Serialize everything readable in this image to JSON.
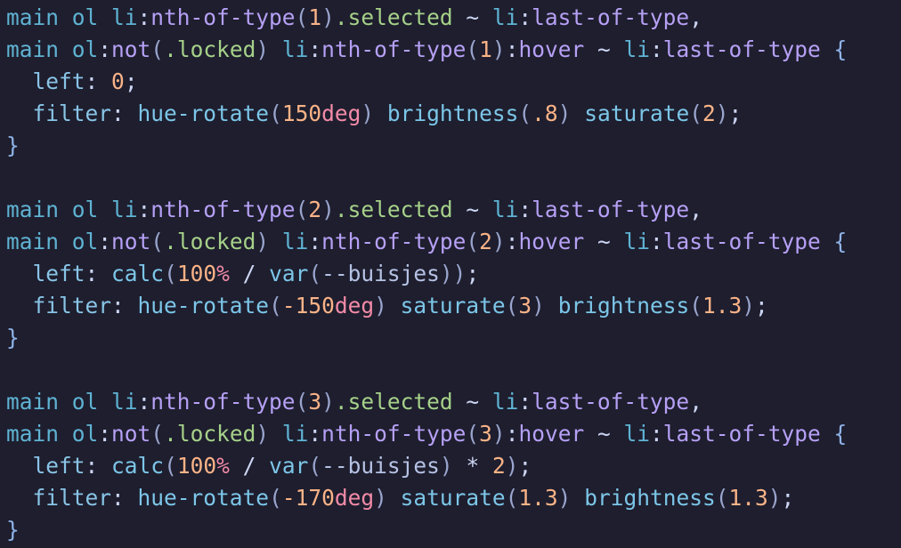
{
  "editor": {
    "colors": {
      "ident": "#5fb3d3",
      "func": "#7cc6e8",
      "punct": "#cdd6f4",
      "paren": "#9aa5ce",
      "pseudo": "#b6a0f5",
      "klass": "#a6d189",
      "number": "#fab387",
      "unit": "#f38ba8",
      "prop": "#89c4e6",
      "brace": "#8fb3e8",
      "var": "#b6c2e4"
    },
    "lines": [
      [
        {
          "t": "main ol ",
          "c": "ident"
        },
        {
          "t": "li",
          "c": "ident"
        },
        {
          "t": ":",
          "c": "punct"
        },
        {
          "t": "nth-of-type",
          "c": "pseudo"
        },
        {
          "t": "(",
          "c": "paren"
        },
        {
          "t": "1",
          "c": "number"
        },
        {
          "t": ")",
          "c": "paren"
        },
        {
          "t": ".selected",
          "c": "klass"
        },
        {
          "t": " ~ ",
          "c": "punct"
        },
        {
          "t": "li",
          "c": "ident"
        },
        {
          "t": ":",
          "c": "punct"
        },
        {
          "t": "last-of-type",
          "c": "pseudo"
        },
        {
          "t": ",",
          "c": "punct"
        }
      ],
      [
        {
          "t": "main ol",
          "c": "ident"
        },
        {
          "t": ":",
          "c": "punct"
        },
        {
          "t": "not",
          "c": "pseudo"
        },
        {
          "t": "(",
          "c": "paren"
        },
        {
          "t": ".locked",
          "c": "klass"
        },
        {
          "t": ") ",
          "c": "paren"
        },
        {
          "t": "li",
          "c": "ident"
        },
        {
          "t": ":",
          "c": "punct"
        },
        {
          "t": "nth-of-type",
          "c": "pseudo"
        },
        {
          "t": "(",
          "c": "paren"
        },
        {
          "t": "1",
          "c": "number"
        },
        {
          "t": ")",
          "c": "paren"
        },
        {
          "t": ":",
          "c": "punct"
        },
        {
          "t": "hover",
          "c": "pseudo"
        },
        {
          "t": " ~ ",
          "c": "punct"
        },
        {
          "t": "li",
          "c": "ident"
        },
        {
          "t": ":",
          "c": "punct"
        },
        {
          "t": "last-of-type",
          "c": "pseudo"
        },
        {
          "t": " {",
          "c": "brace"
        }
      ],
      [
        {
          "t": "  ",
          "c": "punct"
        },
        {
          "t": "left",
          "c": "prop"
        },
        {
          "t": ": ",
          "c": "punct"
        },
        {
          "t": "0",
          "c": "number"
        },
        {
          "t": ";",
          "c": "punct"
        }
      ],
      [
        {
          "t": "  ",
          "c": "punct"
        },
        {
          "t": "filter",
          "c": "prop"
        },
        {
          "t": ": ",
          "c": "punct"
        },
        {
          "t": "hue-rotate",
          "c": "func"
        },
        {
          "t": "(",
          "c": "paren"
        },
        {
          "t": "150",
          "c": "number"
        },
        {
          "t": "deg",
          "c": "unit"
        },
        {
          "t": ") ",
          "c": "paren"
        },
        {
          "t": "brightness",
          "c": "func"
        },
        {
          "t": "(",
          "c": "paren"
        },
        {
          "t": ".8",
          "c": "number"
        },
        {
          "t": ") ",
          "c": "paren"
        },
        {
          "t": "saturate",
          "c": "func"
        },
        {
          "t": "(",
          "c": "paren"
        },
        {
          "t": "2",
          "c": "number"
        },
        {
          "t": ")",
          "c": "paren"
        },
        {
          "t": ";",
          "c": "punct"
        }
      ],
      [
        {
          "t": "}",
          "c": "brace"
        }
      ],
      [],
      [
        {
          "t": "main ol ",
          "c": "ident"
        },
        {
          "t": "li",
          "c": "ident"
        },
        {
          "t": ":",
          "c": "punct"
        },
        {
          "t": "nth-of-type",
          "c": "pseudo"
        },
        {
          "t": "(",
          "c": "paren"
        },
        {
          "t": "2",
          "c": "number"
        },
        {
          "t": ")",
          "c": "paren"
        },
        {
          "t": ".selected",
          "c": "klass"
        },
        {
          "t": " ~ ",
          "c": "punct"
        },
        {
          "t": "li",
          "c": "ident"
        },
        {
          "t": ":",
          "c": "punct"
        },
        {
          "t": "last-of-type",
          "c": "pseudo"
        },
        {
          "t": ",",
          "c": "punct"
        }
      ],
      [
        {
          "t": "main ol",
          "c": "ident"
        },
        {
          "t": ":",
          "c": "punct"
        },
        {
          "t": "not",
          "c": "pseudo"
        },
        {
          "t": "(",
          "c": "paren"
        },
        {
          "t": ".locked",
          "c": "klass"
        },
        {
          "t": ") ",
          "c": "paren"
        },
        {
          "t": "li",
          "c": "ident"
        },
        {
          "t": ":",
          "c": "punct"
        },
        {
          "t": "nth-of-type",
          "c": "pseudo"
        },
        {
          "t": "(",
          "c": "paren"
        },
        {
          "t": "2",
          "c": "number"
        },
        {
          "t": ")",
          "c": "paren"
        },
        {
          "t": ":",
          "c": "punct"
        },
        {
          "t": "hover",
          "c": "pseudo"
        },
        {
          "t": " ~ ",
          "c": "punct"
        },
        {
          "t": "li",
          "c": "ident"
        },
        {
          "t": ":",
          "c": "punct"
        },
        {
          "t": "last-of-type",
          "c": "pseudo"
        },
        {
          "t": " {",
          "c": "brace"
        }
      ],
      [
        {
          "t": "  ",
          "c": "punct"
        },
        {
          "t": "left",
          "c": "prop"
        },
        {
          "t": ": ",
          "c": "punct"
        },
        {
          "t": "calc",
          "c": "func"
        },
        {
          "t": "(",
          "c": "paren"
        },
        {
          "t": "100",
          "c": "number"
        },
        {
          "t": "%",
          "c": "unit"
        },
        {
          "t": " / ",
          "c": "punct"
        },
        {
          "t": "var",
          "c": "func"
        },
        {
          "t": "(",
          "c": "paren"
        },
        {
          "t": "--buisjes",
          "c": "var"
        },
        {
          "t": "))",
          "c": "paren"
        },
        {
          "t": ";",
          "c": "punct"
        }
      ],
      [
        {
          "t": "  ",
          "c": "punct"
        },
        {
          "t": "filter",
          "c": "prop"
        },
        {
          "t": ": ",
          "c": "punct"
        },
        {
          "t": "hue-rotate",
          "c": "func"
        },
        {
          "t": "(",
          "c": "paren"
        },
        {
          "t": "-150",
          "c": "number"
        },
        {
          "t": "deg",
          "c": "unit"
        },
        {
          "t": ") ",
          "c": "paren"
        },
        {
          "t": "saturate",
          "c": "func"
        },
        {
          "t": "(",
          "c": "paren"
        },
        {
          "t": "3",
          "c": "number"
        },
        {
          "t": ") ",
          "c": "paren"
        },
        {
          "t": "brightness",
          "c": "func"
        },
        {
          "t": "(",
          "c": "paren"
        },
        {
          "t": "1.3",
          "c": "number"
        },
        {
          "t": ")",
          "c": "paren"
        },
        {
          "t": ";",
          "c": "punct"
        }
      ],
      [
        {
          "t": "}",
          "c": "brace"
        }
      ],
      [],
      [
        {
          "t": "main ol ",
          "c": "ident"
        },
        {
          "t": "li",
          "c": "ident"
        },
        {
          "t": ":",
          "c": "punct"
        },
        {
          "t": "nth-of-type",
          "c": "pseudo"
        },
        {
          "t": "(",
          "c": "paren"
        },
        {
          "t": "3",
          "c": "number"
        },
        {
          "t": ")",
          "c": "paren"
        },
        {
          "t": ".selected",
          "c": "klass"
        },
        {
          "t": " ~ ",
          "c": "punct"
        },
        {
          "t": "li",
          "c": "ident"
        },
        {
          "t": ":",
          "c": "punct"
        },
        {
          "t": "last-of-type",
          "c": "pseudo"
        },
        {
          "t": ",",
          "c": "punct"
        }
      ],
      [
        {
          "t": "main ol",
          "c": "ident"
        },
        {
          "t": ":",
          "c": "punct"
        },
        {
          "t": "not",
          "c": "pseudo"
        },
        {
          "t": "(",
          "c": "paren"
        },
        {
          "t": ".locked",
          "c": "klass"
        },
        {
          "t": ") ",
          "c": "paren"
        },
        {
          "t": "li",
          "c": "ident"
        },
        {
          "t": ":",
          "c": "punct"
        },
        {
          "t": "nth-of-type",
          "c": "pseudo"
        },
        {
          "t": "(",
          "c": "paren"
        },
        {
          "t": "3",
          "c": "number"
        },
        {
          "t": ")",
          "c": "paren"
        },
        {
          "t": ":",
          "c": "punct"
        },
        {
          "t": "hover",
          "c": "pseudo"
        },
        {
          "t": " ~ ",
          "c": "punct"
        },
        {
          "t": "li",
          "c": "ident"
        },
        {
          "t": ":",
          "c": "punct"
        },
        {
          "t": "last-of-type",
          "c": "pseudo"
        },
        {
          "t": " {",
          "c": "brace"
        }
      ],
      [
        {
          "t": "  ",
          "c": "punct"
        },
        {
          "t": "left",
          "c": "prop"
        },
        {
          "t": ": ",
          "c": "punct"
        },
        {
          "t": "calc",
          "c": "func"
        },
        {
          "t": "(",
          "c": "paren"
        },
        {
          "t": "100",
          "c": "number"
        },
        {
          "t": "%",
          "c": "unit"
        },
        {
          "t": " / ",
          "c": "punct"
        },
        {
          "t": "var",
          "c": "func"
        },
        {
          "t": "(",
          "c": "paren"
        },
        {
          "t": "--buisjes",
          "c": "var"
        },
        {
          "t": ")",
          "c": "paren"
        },
        {
          "t": " * ",
          "c": "punct"
        },
        {
          "t": "2",
          "c": "number"
        },
        {
          "t": ")",
          "c": "paren"
        },
        {
          "t": ";",
          "c": "punct"
        }
      ],
      [
        {
          "t": "  ",
          "c": "punct"
        },
        {
          "t": "filter",
          "c": "prop"
        },
        {
          "t": ": ",
          "c": "punct"
        },
        {
          "t": "hue-rotate",
          "c": "func"
        },
        {
          "t": "(",
          "c": "paren"
        },
        {
          "t": "-170",
          "c": "number"
        },
        {
          "t": "deg",
          "c": "unit"
        },
        {
          "t": ") ",
          "c": "paren"
        },
        {
          "t": "saturate",
          "c": "func"
        },
        {
          "t": "(",
          "c": "paren"
        },
        {
          "t": "1.3",
          "c": "number"
        },
        {
          "t": ") ",
          "c": "paren"
        },
        {
          "t": "brightness",
          "c": "func"
        },
        {
          "t": "(",
          "c": "paren"
        },
        {
          "t": "1.3",
          "c": "number"
        },
        {
          "t": ")",
          "c": "paren"
        },
        {
          "t": ";",
          "c": "punct"
        }
      ],
      [
        {
          "t": "}",
          "c": "brace"
        }
      ]
    ]
  }
}
